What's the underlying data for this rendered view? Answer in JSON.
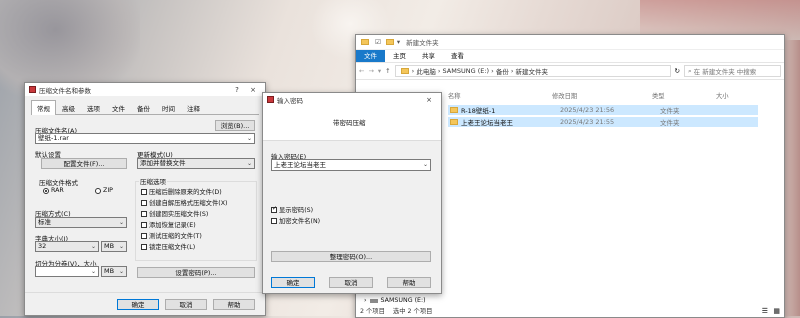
{
  "archive_dialog": {
    "title": "压缩文件名和参数",
    "help_button": "?",
    "close_button": "×",
    "tabs": [
      "常规",
      "高级",
      "选项",
      "文件",
      "备份",
      "时间",
      "注释"
    ],
    "filename_label": "压缩文件名(A)",
    "browse_button": "浏览(B)...",
    "filename_value": "壁纸-1.rar",
    "default_settings_label": "默认设置",
    "profiles_button": "配置文件(F)...",
    "update_mode_label": "更新模式(U)",
    "update_mode_value": "添加并替换文件",
    "format_group_label": "压缩文件格式",
    "format_rar": "RAR",
    "format_zip": "ZIP",
    "method_label": "压缩方式(C)",
    "method_value": "标准",
    "dict_label": "字典大小(I)",
    "dict_value": "32",
    "dict_unit": "MB",
    "split_label": "切分为分卷(V)，大小",
    "split_unit": "MB",
    "options_group_label": "压缩选项",
    "options": [
      "压缩后删除原来的文件(D)",
      "创建自解压格式压缩文件(X)",
      "创建固实压缩文件(S)",
      "添加恢复记录(E)",
      "测试压缩的文件(T)",
      "锁定压缩文件(L)"
    ],
    "set_password_button": "设置密码(P)...",
    "ok_button": "确定",
    "cancel_button": "取消",
    "help_footer_button": "帮助"
  },
  "password_dialog": {
    "title": "输入密码",
    "close_button": "×",
    "heading": "带密码压缩",
    "password_label": "输入密码(E)",
    "password_value": "上老王论坛当老王",
    "show_password_label": "显示密码(S)",
    "encrypt_names_label": "加密文件名(N)",
    "manage_button": "整理密码(O)...",
    "ok_button": "确定",
    "cancel_button": "取消",
    "help_button": "帮助"
  },
  "explorer": {
    "title": "新建文件夹",
    "ribbon_tabs": [
      "文件",
      "主页",
      "共享",
      "查看"
    ],
    "breadcrumb": [
      "此电脑",
      "SAMSUNG (E:)",
      "备份",
      "新建文件夹"
    ],
    "search_placeholder": "在 新建文件夹 中搜索",
    "columns": [
      "名称",
      "修改日期",
      "类型",
      "大小"
    ],
    "files": [
      {
        "name": "R-18壁纸-1",
        "date": "2025/4/23 21:56",
        "type": "文件夹"
      },
      {
        "name": "上老王论坛当老王",
        "date": "2025/4/23 21:55",
        "type": "文件夹"
      }
    ],
    "nav_item": "SAMSUNG (E:)",
    "status_count": "2 个项目",
    "status_selected": "选中 2 个项目"
  },
  "colors": {
    "accent": "#1979ca",
    "selection": "#cce8ff",
    "folder": "#f4c65a"
  }
}
